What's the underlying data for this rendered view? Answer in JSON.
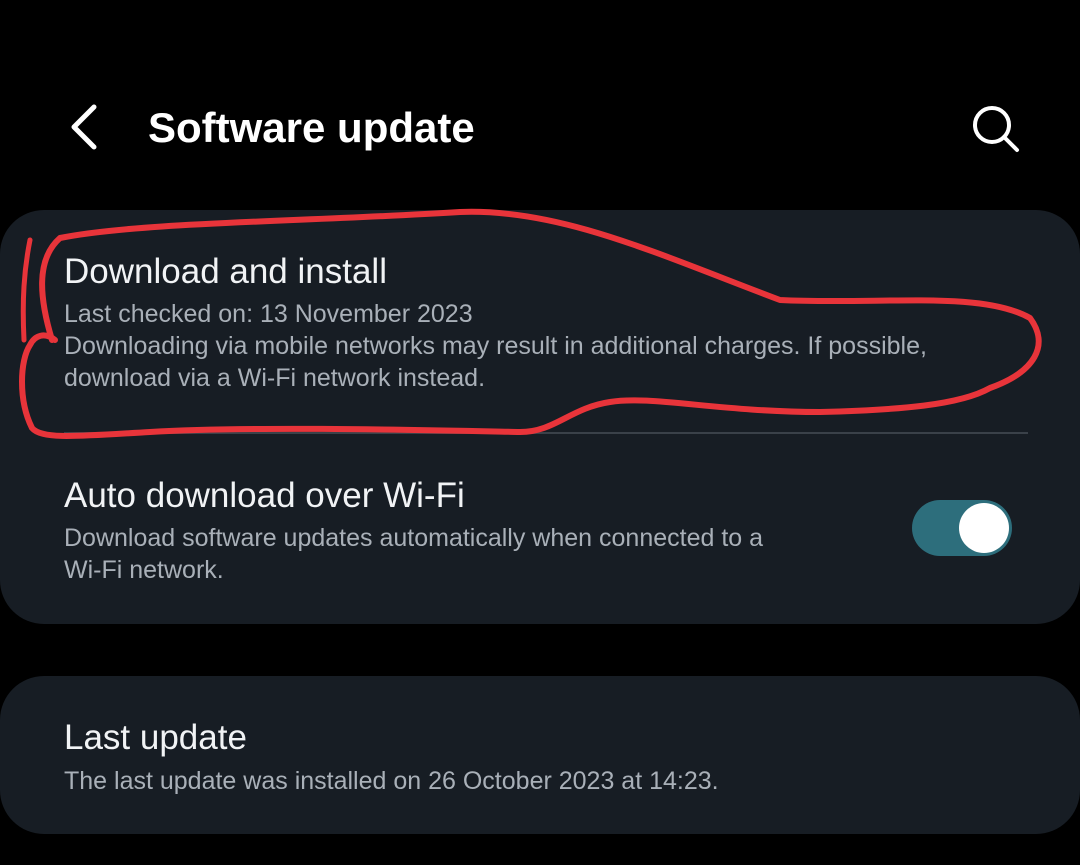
{
  "header": {
    "title": "Software update",
    "back_icon": "chevron-left-icon",
    "search_icon": "search-icon"
  },
  "card_main": {
    "download": {
      "title": "Download and install",
      "last_checked": "Last checked on: 13 November 2023",
      "note_line1": "Downloading via mobile networks may result in additional charges. If possible,",
      "note_line2": "download via a Wi-Fi network instead."
    },
    "auto_download": {
      "title": "Auto download over Wi-Fi",
      "desc_line1": "Download software updates automatically when connected to a",
      "desc_line2": "Wi-Fi network.",
      "enabled": true
    }
  },
  "card_last": {
    "title": "Last update",
    "desc": "The last update was installed on 26 October 2023 at 14:23."
  },
  "colors": {
    "background": "#000000",
    "card": "#171d24",
    "toggle_on": "#2d6e7c",
    "annotation": "#e8343a"
  }
}
